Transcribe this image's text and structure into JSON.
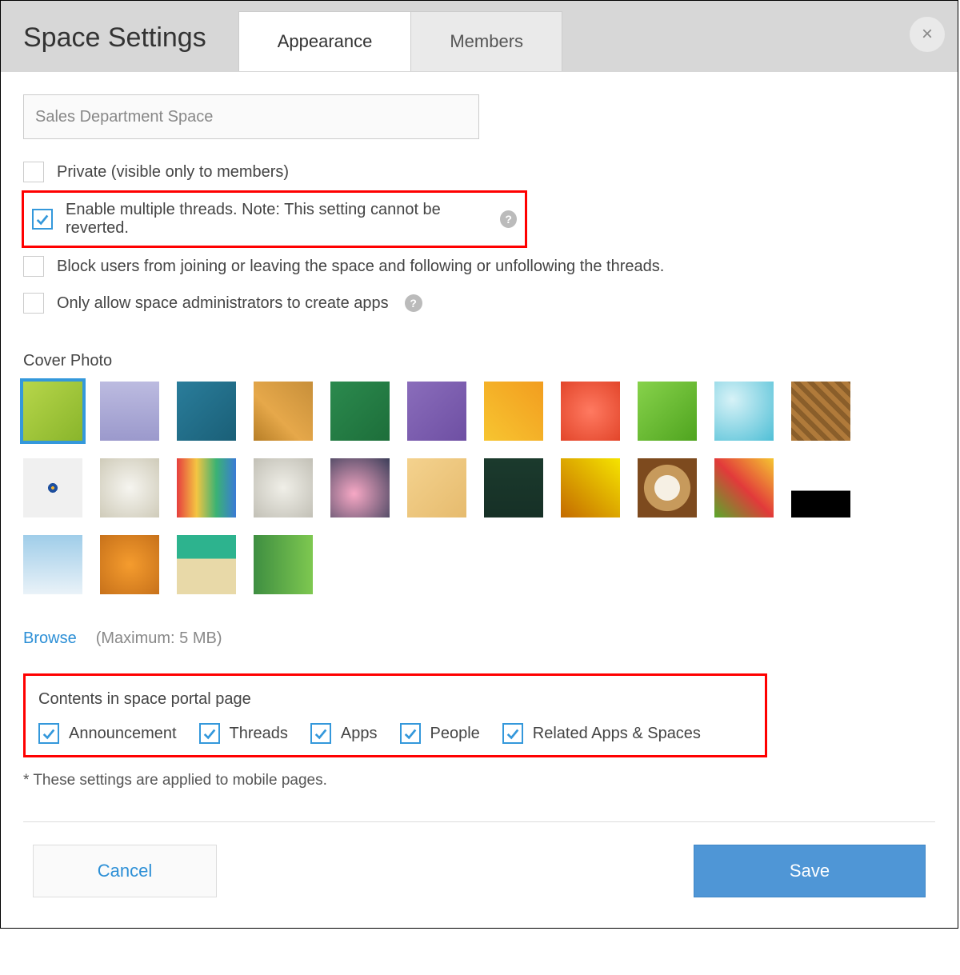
{
  "header": {
    "title": "Space Settings",
    "tabs": [
      {
        "label": "Appearance",
        "active": true
      },
      {
        "label": "Members",
        "active": false
      }
    ]
  },
  "form": {
    "name_value": "Sales Department Space"
  },
  "options": [
    {
      "key": "private",
      "label": "Private (visible only to members)",
      "checked": false,
      "highlighted": false,
      "help": false
    },
    {
      "key": "threads",
      "label": "Enable multiple threads. Note: This setting cannot be reverted.",
      "checked": true,
      "highlighted": true,
      "help": true
    },
    {
      "key": "block",
      "label": "Block users from joining or leaving the space and following or unfollowing the threads.",
      "checked": false,
      "highlighted": false,
      "help": false
    },
    {
      "key": "adminapp",
      "label": "Only allow space administrators to create apps",
      "checked": false,
      "highlighted": false,
      "help": true
    }
  ],
  "cover": {
    "label": "Cover Photo",
    "selected_index": 0,
    "thumbs": [
      "linear-gradient(135deg,#b7d64a,#89b52b)",
      "linear-gradient(180deg,#bcbbe0,#9b99cc)",
      "linear-gradient(135deg,#2a7d9b,#1a5f77)",
      "linear-gradient(45deg,#b77e26,#e6a84a 40%,#c78f3a)",
      "linear-gradient(135deg,#2b8a4e,#1d6e3a)",
      "linear-gradient(135deg,#8a6dbb,#6e4fa3)",
      "linear-gradient(45deg,#f7c531,#f29d1f)",
      "radial-gradient(circle,#ff7a61,#e2452a)",
      "linear-gradient(135deg,#87d24b,#4fa41f)",
      "radial-gradient(circle at 30% 30%,#d7f2f7,#4fbfd6)",
      "repeating-linear-gradient(45deg,#b07a3a 0 6px,#8a5e2a 6px 12px)",
      "radial-gradient(circle,#f0b233 2px,#1e4f9e 2px 6px,#f0f0f0 6px 10px)",
      "radial-gradient(circle at 50% 50%,#f6f5f0,#cfcbb9)",
      "linear-gradient(90deg,#e63e3e,#f4c542,#3bb273,#3a7bd5)",
      "radial-gradient(circle,#f0efe8,#c2c0b6)",
      "radial-gradient(circle at 40% 60%,#f7a8c5,#3b3e59)",
      "linear-gradient(135deg,#f4d28e,#e6bb6e)",
      "linear-gradient(180deg,#1b3a2d,#163026)",
      "linear-gradient(45deg,#c46a00,#f5e400)",
      "radial-gradient(circle,#f6f0e4 30%,#c79a5c 31% 55%,#7d4a1e 56%)",
      "linear-gradient(45deg,#5aa82b,#e23a3a,#f5c531)",
      "linear-gradient(180deg,#ffffff 55%,#000 55%)",
      "linear-gradient(180deg,#9fcde9,#e9f2f8)",
      "radial-gradient(circle,#f59c2e,#c7711a)",
      "linear-gradient(180deg,#2db38e 40%,#e8d9a8 40%)",
      "linear-gradient(90deg,#3e8e41,#7ec850)"
    ],
    "browse_label": "Browse",
    "browse_note": "(Maximum: 5 MB)"
  },
  "portal": {
    "label": "Contents in space portal page",
    "items": [
      {
        "label": "Announcement",
        "checked": true
      },
      {
        "label": "Threads",
        "checked": true
      },
      {
        "label": "Apps",
        "checked": true
      },
      {
        "label": "People",
        "checked": true
      },
      {
        "label": "Related Apps & Spaces",
        "checked": true
      }
    ]
  },
  "footnote": "* These settings are applied to mobile pages.",
  "footer": {
    "cancel": "Cancel",
    "save": "Save"
  }
}
